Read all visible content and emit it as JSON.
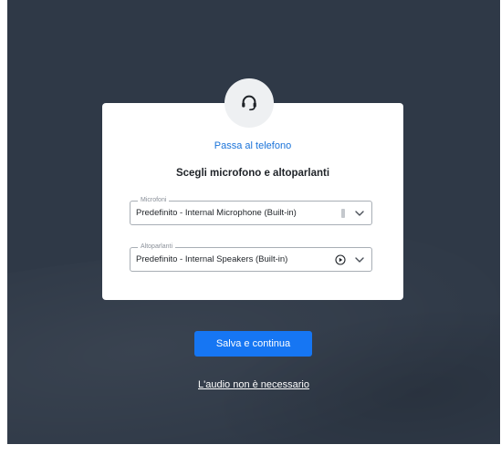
{
  "dialog": {
    "phone_link": "Passa al telefono",
    "heading": "Scegli microfono e altoparlanti",
    "microphone": {
      "legend": "Microfoni",
      "value": "Predefinito - Internal Microphone (Built-in)"
    },
    "speakers": {
      "legend": "Altoparlanti",
      "value": "Predefinito - Internal Speakers (Built-in)"
    }
  },
  "actions": {
    "save_label": "Salva e continua",
    "skip_label": "L'audio non è necessario"
  },
  "icons": {
    "top": "headset-icon",
    "mic_level": "level-meter-icon",
    "speaker_test": "play-icon",
    "dropdown": "chevron-down-icon"
  },
  "colors": {
    "background": "#2f3947",
    "accent": "#1676f3",
    "link": "#1a73d9"
  }
}
